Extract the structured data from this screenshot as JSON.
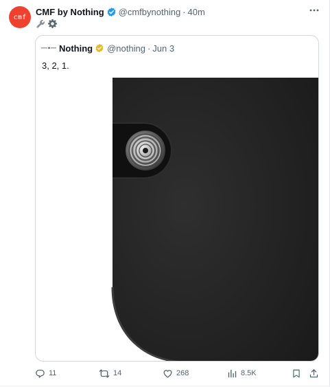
{
  "tweet": {
    "author_name": "CMF by Nothing",
    "avatar_text": "cmf",
    "handle": "@cmfbynothing",
    "separator": "·",
    "time": "40m",
    "text_icons": [
      "wrench-icon",
      "gear-icon"
    ]
  },
  "quote": {
    "author_name": "Nothing",
    "handle": "@nothing",
    "separator": "·",
    "date": "Jun 3",
    "text": "3, 2, 1.",
    "media": "black phone back with camera lens"
  },
  "actions": {
    "reply_count": "11",
    "retweet_count": "14",
    "like_count": "268",
    "views_count": "8.5K"
  },
  "colors": {
    "avatar_bg": "#f0412f",
    "verified_blue": "#1d9bf0",
    "verified_gold": "#e8b923",
    "muted_text": "#536471",
    "border": "#cfd9de"
  }
}
